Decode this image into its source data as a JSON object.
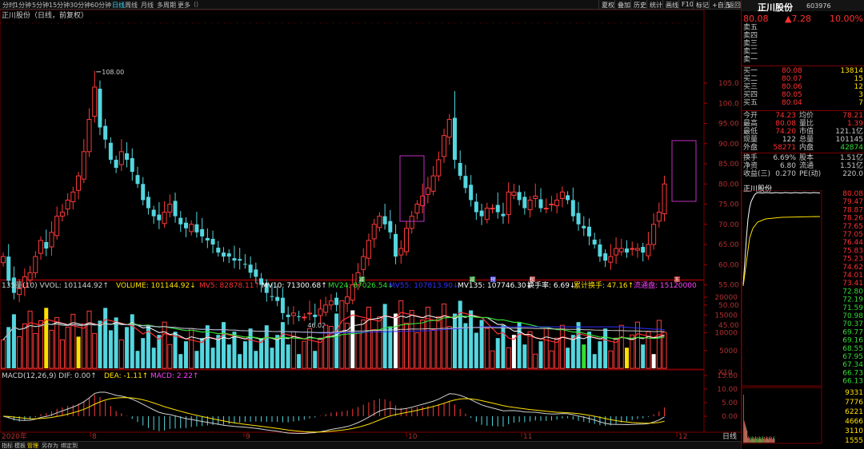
{
  "toolbar": {
    "period_tabs": [
      "分时",
      "1分钟",
      "5分钟",
      "15分钟",
      "30分钟",
      "60分钟",
      "日线",
      "周线",
      "月线",
      "多周期",
      "更多"
    ],
    "active_period": "日线",
    "right_buttons": [
      "夏权",
      "叠加",
      "历史",
      "统计",
      "画线",
      "F10",
      "标记",
      "+自选",
      "返回"
    ]
  },
  "chart": {
    "title": "正川股份（日线，前复权）",
    "max_label": "108.00",
    "min_label": "46.02",
    "price_ticks": [
      "105.0",
      "100.0",
      "95.00",
      "90.00",
      "85.00",
      "80.00",
      "75.00",
      "70.00",
      "65.00",
      "60.00",
      "55.00",
      "50.00",
      "45.00"
    ],
    "event_markers": [
      {
        "label": "减",
        "color": "#2e8b2e"
      },
      {
        "label": "减",
        "color": "#2e8b2e"
      },
      {
        "label": "预",
        "color": "#3a3ad0"
      },
      {
        "label": "权",
        "color": "#b05050"
      },
      {
        "label": "冻",
        "color": "#c03030"
      }
    ]
  },
  "volume_panel": {
    "legend": [
      {
        "text": "135量(10) VVOL: 101144.92↑",
        "color": "#d0d0d0"
      },
      {
        "text": "VOLUME: 101144.92↓",
        "color": "#ffe000"
      },
      {
        "text": "MV5: 82878.11↑",
        "color": "#ff3030"
      },
      {
        "text": "MV10: 71300.68↑",
        "color": "#ffffff"
      },
      {
        "text": "MV24: 87026.54↓",
        "color": "#33dd33"
      },
      {
        "text": "MV55: 107813.90↓",
        "color": "#3030ff"
      },
      {
        "text": "MV135: 107746.30↓",
        "color": "#ffffff"
      },
      {
        "text": "换手率: 6.69↓",
        "color": "#ffffff"
      },
      {
        "text": "累计换手: 47.16↑",
        "color": "#ffe000"
      },
      {
        "text": "流通盘: 15120000",
        "color": "#ff40ff"
      }
    ],
    "ticks": [
      "20000",
      "15000",
      "10000",
      "5000"
    ],
    "unit": "X10"
  },
  "macd_panel": {
    "legend": [
      {
        "text": "MACD(12,26,9) DIF: 0.00↑",
        "color": "#d0d0d0"
      },
      {
        "text": "DEA: -1.11↑",
        "color": "#ffe000"
      },
      {
        "text": "MACD: 2.22↑",
        "color": "#ff40ff"
      }
    ],
    "ticks": [
      "15.00",
      "10.00",
      "5.00",
      "0.00"
    ]
  },
  "date_axis": {
    "year": "2020年",
    "months": [
      "8",
      "9",
      "10",
      "11",
      "12"
    ],
    "period_button": "日线"
  },
  "bottom_tabs": [
    "指标",
    "模板",
    "管理",
    "另存为",
    "绑定到"
  ],
  "active_bottom_tab": "管理",
  "quote": {
    "name": "正川股份",
    "code": "603976",
    "price": "80.08",
    "change": "▲7.28",
    "change_pct": "10.00%",
    "asks": [
      {
        "label": "卖五",
        "price": "",
        "vol": ""
      },
      {
        "label": "卖四",
        "price": "",
        "vol": ""
      },
      {
        "label": "卖三",
        "price": "",
        "vol": ""
      },
      {
        "label": "卖二",
        "price": "",
        "vol": ""
      },
      {
        "label": "卖一",
        "price": "",
        "vol": ""
      }
    ],
    "bids": [
      {
        "label": "买一",
        "price": "80.08",
        "vol": "13814"
      },
      {
        "label": "买二",
        "price": "80.07",
        "vol": "15"
      },
      {
        "label": "买三",
        "price": "80.06",
        "vol": "12"
      },
      {
        "label": "买四",
        "price": "80.05",
        "vol": "3"
      },
      {
        "label": "买五",
        "price": "80.04",
        "vol": "7"
      }
    ],
    "stats": [
      {
        "l1": "今开",
        "v1": "74.23",
        "l2": "均价",
        "v2": "78.21",
        "c1": "#ff3030",
        "c2": "#ff3030"
      },
      {
        "l1": "最高",
        "v1": "80.08",
        "l2": "量比",
        "v2": "1.39",
        "c1": "#ff3030",
        "c2": "#ff3030"
      },
      {
        "l1": "最低",
        "v1": "74.20",
        "l2": "市值",
        "v2": "121.1亿",
        "c1": "#ff3030",
        "c2": "#c8c8c8"
      },
      {
        "l1": "现量",
        "v1": "122",
        "l2": "总量",
        "v2": "101145",
        "c1": "#c8c8c8",
        "c2": "#c8c8c8"
      },
      {
        "l1": "外盘",
        "v1": "58271",
        "l2": "内盘",
        "v2": "42874",
        "c1": "#ff3030",
        "c2": "#33dd33"
      }
    ],
    "stats2": [
      {
        "l1": "换手",
        "v1": "6.69%",
        "l2": "股本",
        "v2": "1.51亿"
      },
      {
        "l1": "净资",
        "v1": "6.80",
        "l2": "流通",
        "v2": "1.51亿"
      },
      {
        "l1": "收益(三)",
        "v1": "0.270",
        "l2": "PE(动)",
        "v2": "220.0"
      }
    ]
  },
  "mini": {
    "title": "正川股份",
    "price_ticks": [
      "80.08",
      "79.47",
      "78.87",
      "78.26",
      "77.65",
      "77.05",
      "76.44",
      "75.83",
      "75.23",
      "74.62",
      "74.01",
      "73.41",
      "72.80",
      "72.19",
      "71.59",
      "70.98",
      "70.37",
      "69.77",
      "69.16",
      "68.55",
      "67.95",
      "67.34",
      "66.73",
      "66.13"
    ],
    "vol_ticks": [
      "9331",
      "7776",
      "6221",
      "4666",
      "3110",
      "1555"
    ]
  }
}
